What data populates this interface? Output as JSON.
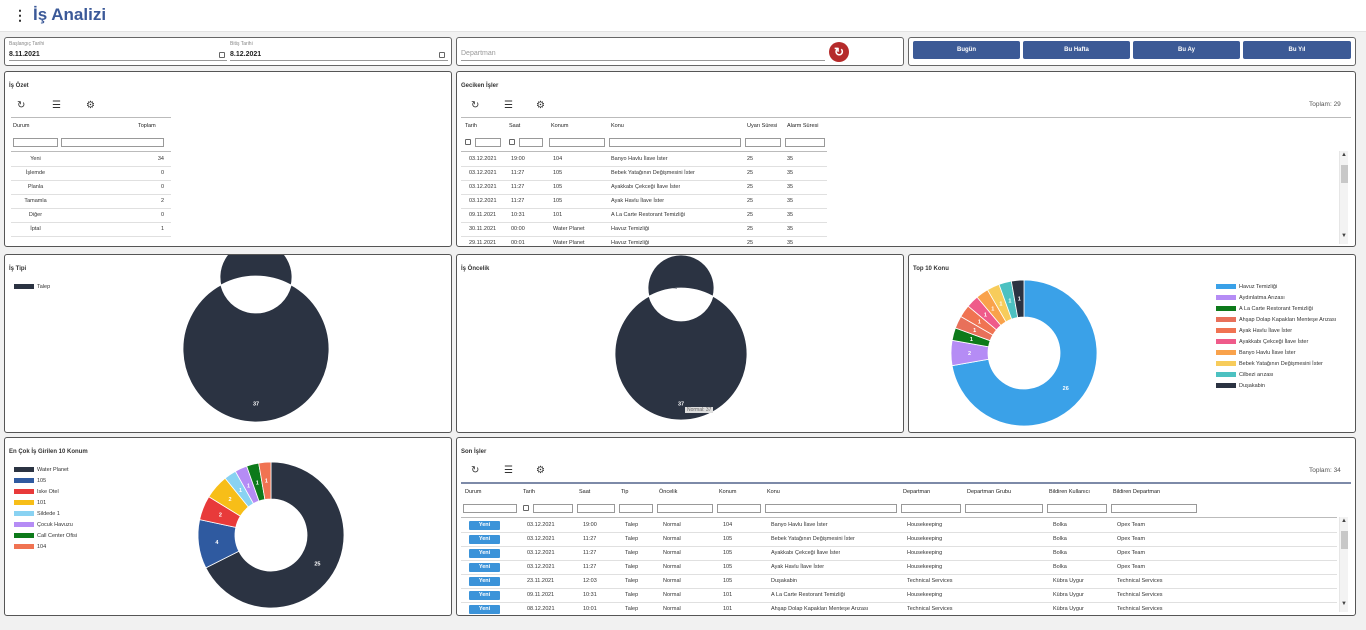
{
  "header": {
    "menu_icon": "kebab-menu-icon",
    "title": "İş Analizi"
  },
  "filters": {
    "start_label": "Başlangıç Tarihi",
    "start_value": "8.11.2021",
    "end_label": "Bitiş Tarihi",
    "end_value": "8.12.2021",
    "department_placeholder": "Departman",
    "refresh_icon": "refresh-icon"
  },
  "quick": {
    "today": "Bugün",
    "week": "Bu Hafta",
    "month": "Bu Ay",
    "year": "Bu Yıl"
  },
  "summary": {
    "title": "İş Özet",
    "col_status": "Durum",
    "col_total": "Toplam",
    "rows": [
      {
        "status": "Yeni",
        "total": "34"
      },
      {
        "status": "İşlemde",
        "total": "0"
      },
      {
        "status": "Planla",
        "total": "0"
      },
      {
        "status": "Tamamla",
        "total": "2"
      },
      {
        "status": "Diğer",
        "total": "0"
      },
      {
        "status": "İptal",
        "total": "1"
      }
    ]
  },
  "delayed": {
    "title": "Geciken İşler",
    "total": "Toplam: 29",
    "cols": [
      "Tarih",
      "Saat",
      "Konum",
      "Konu",
      "Uyarı Süresi",
      "Alarm Süresi"
    ],
    "rows": [
      [
        "03.12.2021",
        "19:00",
        "104",
        "Banyo Havlu İlave İster",
        "25",
        "35"
      ],
      [
        "03.12.2021",
        "11:27",
        "105",
        "Bebek Yatağının Değişmesini İster",
        "25",
        "35"
      ],
      [
        "03.12.2021",
        "11:27",
        "105",
        "Ayakkabı Çekceği İlave İster",
        "25",
        "35"
      ],
      [
        "03.12.2021",
        "11:27",
        "105",
        "Ayak Havlu İlave İster",
        "25",
        "35"
      ],
      [
        "09.11.2021",
        "10:31",
        "101",
        "A La Carte Restorant Temizliği",
        "25",
        "35"
      ],
      [
        "30.11.2021",
        "00:00",
        "Water Planet",
        "Havuz Temizliği",
        "25",
        "35"
      ],
      [
        "29.11.2021",
        "00:01",
        "Water Planet",
        "Havuz Temizliği",
        "25",
        "35"
      ]
    ]
  },
  "type_chart": {
    "title": "İş Tipi"
  },
  "priority_chart": {
    "title": "İş Öncelik",
    "hover_label": "Normal: 37"
  },
  "top_chart": {
    "title": "Top 10 Konu"
  },
  "loc_chart": {
    "title": "En Çok İş Girilen 10 Konum"
  },
  "recent": {
    "title": "Son İşler",
    "total": "Toplam: 34",
    "cols": [
      "Durum",
      "Tarih",
      "Saat",
      "Tip",
      "Öncelik",
      "Konum",
      "Konu",
      "Departman",
      "Departman Grubu",
      "Bildiren Kullanıcı",
      "Bildiren Departman"
    ],
    "rows": [
      [
        "Yeni",
        "03.12.2021",
        "19:00",
        "Talep",
        "Normal",
        "104",
        "Banyo Havlu İlave İster",
        "Housekeeping",
        "",
        "Bolka",
        "Opex Team"
      ],
      [
        "Yeni",
        "03.12.2021",
        "11:27",
        "Talep",
        "Normal",
        "105",
        "Bebek Yatağının Değişmesini İster",
        "Housekeeping",
        "",
        "Bolka",
        "Opex Team"
      ],
      [
        "Yeni",
        "03.12.2021",
        "11:27",
        "Talep",
        "Normal",
        "105",
        "Ayakkabı Çekceği İlave İster",
        "Housekeeping",
        "",
        "Bolka",
        "Opex Team"
      ],
      [
        "Yeni",
        "03.12.2021",
        "11:27",
        "Talep",
        "Normal",
        "105",
        "Ayak Havlu İlave İster",
        "Housekeeping",
        "",
        "Bolka",
        "Opex Team"
      ],
      [
        "Yeni",
        "23.11.2021",
        "12:03",
        "Talep",
        "Normal",
        "105",
        "Duşakabin",
        "Technical Services",
        "",
        "Kübra Uygur",
        "Technical Services"
      ],
      [
        "Yeni",
        "09.11.2021",
        "10:31",
        "Talep",
        "Normal",
        "101",
        "A La Carte Restorant Temizliği",
        "Housekeeping",
        "",
        "Kübra Uygur",
        "Technical Services"
      ],
      [
        "Yeni",
        "08.12.2021",
        "10:01",
        "Talep",
        "Normal",
        "101",
        "Ahşap Dolap Kapakları Menteşe Arızası",
        "Technical Services",
        "",
        "Kübra Uygur",
        "Technical Services"
      ]
    ]
  },
  "chart_data": [
    {
      "type": "pie",
      "title": "İş Tipi",
      "donut": true,
      "series": [
        {
          "name": "Talep",
          "value": 37,
          "color": "#2b3342"
        }
      ]
    },
    {
      "type": "pie",
      "title": "İş Öncelik",
      "donut": true,
      "series": [
        {
          "name": "Normal",
          "value": 37,
          "color": "#2b3342"
        }
      ]
    },
    {
      "type": "pie",
      "title": "Top 10 Konu",
      "donut": true,
      "series": [
        {
          "name": "Havuz Temizliği",
          "value": 26,
          "color": "#3aa1e8"
        },
        {
          "name": "Aydınlatma Arızası",
          "value": 2,
          "color": "#b58cf5"
        },
        {
          "name": "A La Carte Restorant Temizliği",
          "value": 1,
          "color": "#0d7a1a"
        },
        {
          "name": "Ahşap Dolap Kapakları Menteşe Arızası",
          "value": 1,
          "color": "#e8705a"
        },
        {
          "name": "Ayak Havlu İlave İster",
          "value": 1,
          "color": "#f07352"
        },
        {
          "name": "Ayakkabı Çekceği İlave İster",
          "value": 1,
          "color": "#ef5b8a"
        },
        {
          "name": "Banyo Havlu İlave İster",
          "value": 1,
          "color": "#f9a24b"
        },
        {
          "name": "Bebek Yatağının Değişmesini İster",
          "value": 1,
          "color": "#f7cc5b"
        },
        {
          "name": "Cilbezi arızası",
          "value": 1,
          "color": "#4cc1c1"
        },
        {
          "name": "Duşakabin",
          "value": 1,
          "color": "#2b3342"
        }
      ]
    },
    {
      "type": "pie",
      "title": "En Çok İş Girilen 10 Konum",
      "donut": true,
      "series": [
        {
          "name": "Water Planet",
          "value": 25,
          "color": "#2b3342"
        },
        {
          "name": "105",
          "value": 4,
          "color": "#2f5aa0"
        },
        {
          "name": "Iske Otel",
          "value": 2,
          "color": "#e83a3a"
        },
        {
          "name": "101",
          "value": 2,
          "color": "#f7be18"
        },
        {
          "name": "Sildede 1",
          "value": 1,
          "color": "#89d2f2"
        },
        {
          "name": "Çocuk Havuzu",
          "value": 1,
          "color": "#b58cf5"
        },
        {
          "name": "Call Center Ofisi",
          "value": 1,
          "color": "#0d7a1a"
        },
        {
          "name": "104",
          "value": 1,
          "color": "#f07352"
        }
      ]
    }
  ]
}
